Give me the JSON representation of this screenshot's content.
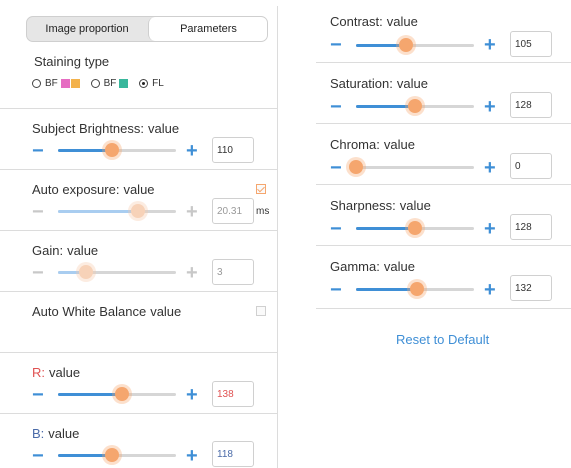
{
  "tabs": {
    "image_proportion": "Image proportion",
    "parameters": "Parameters"
  },
  "staining": {
    "title": "Staining type",
    "options": [
      {
        "label": "BF",
        "checked": false,
        "swatches": [
          "#e66dc2",
          "#f3b24c"
        ]
      },
      {
        "label": "BF",
        "checked": false,
        "swatches": [
          "#39b79c"
        ]
      },
      {
        "label": "FL",
        "checked": true,
        "swatches": []
      }
    ]
  },
  "left": {
    "brightness": {
      "name": "Subject Brightness:",
      "value_word": "value",
      "value": "110",
      "level": 0.46
    },
    "exposure": {
      "name": "Auto exposure:",
      "value_word": "value",
      "value": "20.31",
      "unit": "ms",
      "level": 0.68,
      "checked": true
    },
    "gain": {
      "name": "Gain:",
      "value_word": "value",
      "value": "3",
      "level": 0.24
    },
    "awb": {
      "name": "Auto White Balance",
      "value_word": "value",
      "checked": false
    },
    "r": {
      "name": "R:",
      "value_word": "value",
      "value": "138",
      "level": 0.54
    },
    "b": {
      "name": "B:",
      "value_word": "value",
      "value": "118",
      "level": 0.46
    }
  },
  "right": {
    "contrast": {
      "name": "Contrast:",
      "value_word": "value",
      "value": "105",
      "level": 0.42
    },
    "saturation": {
      "name": "Saturation:",
      "value_word": "value",
      "value": "128",
      "level": 0.5
    },
    "chroma": {
      "name": "Chroma:",
      "value_word": "value",
      "value": "0",
      "level": 0.0
    },
    "sharpness": {
      "name": "Sharpness:",
      "value_word": "value",
      "value": "128",
      "level": 0.5
    },
    "gamma": {
      "name": "Gamma:",
      "value_word": "value",
      "value": "132",
      "level": 0.52
    }
  },
  "reset_label": "Reset to Default",
  "colors": {
    "accent": "#3f8fd6",
    "thumb": "#f5a66e",
    "red": "#e05252",
    "blue": "#4a6aa8"
  },
  "icons": {
    "minus": "minus-icon",
    "plus": "plus-icon"
  }
}
